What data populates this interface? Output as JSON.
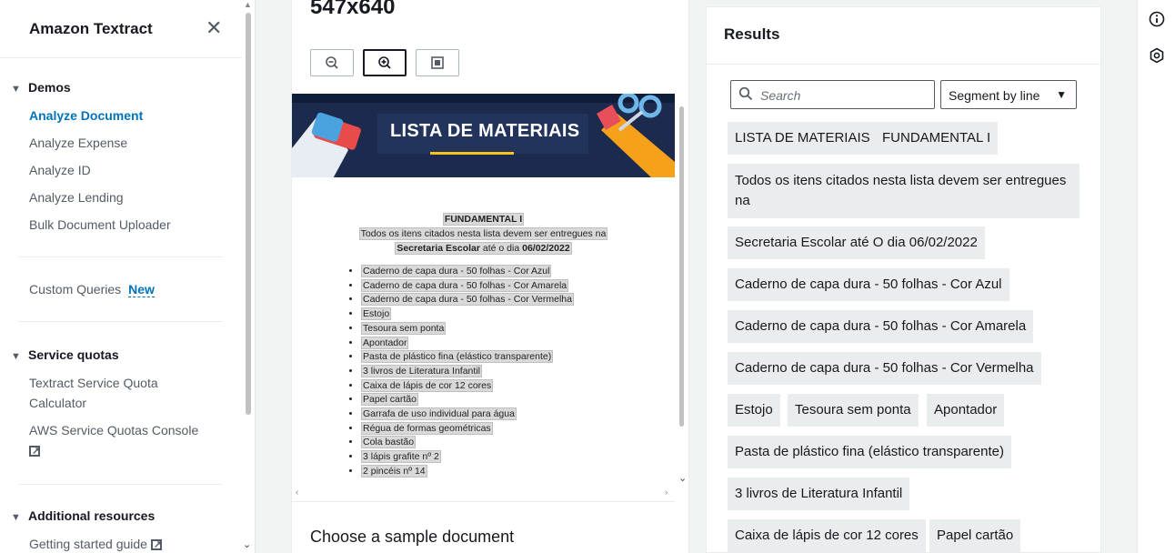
{
  "sidebar": {
    "title": "Amazon Textract",
    "sections": {
      "demos": "Demos",
      "service_quotas": "Service quotas",
      "additional_resources": "Additional resources"
    },
    "demos_items": [
      "Analyze Document",
      "Analyze Expense",
      "Analyze ID",
      "Analyze Lending",
      "Bulk Document Uploader"
    ],
    "custom_queries": "Custom Queries",
    "new_badge": "New",
    "quota_items": [
      "Textract Service Quota Calculator",
      "AWS Service Quotas Console"
    ],
    "resources_items": [
      "Getting started guide"
    ]
  },
  "viewer": {
    "dimensions": "547x640",
    "banner_title": "LISTA DE MATERIAIS",
    "doc_heading": "FUNDAMENTAL I",
    "doc_line1": "Todos os itens citados nesta lista devem ser entregues na",
    "doc_line2a": "Secretaria Escolar",
    "doc_line2b": "até o dia",
    "doc_line2c": "06/02/2022",
    "doc_items": [
      "Caderno de capa dura - 50 folhas - Cor Azul",
      "Caderno de capa dura - 50 folhas - Cor Amarela",
      "Caderno de capa dura - 50 folhas - Cor Vermelha",
      "Estojo",
      "Tesoura sem ponta",
      "Apontador",
      "Pasta de plástico fina (elástico transparente)",
      "3 livros de Literatura Infantil",
      "Caixa de lápis de cor 12 cores",
      "Papel cartão",
      "Garrafa de uso individual para água",
      "Régua de formas geométricas",
      "Cola bastão",
      "3 lápis grafite nº 2",
      "2 pincéis nº 14"
    ],
    "choose_label": "Choose a sample document"
  },
  "results": {
    "title": "Results",
    "search_placeholder": "Search",
    "segment_label": "Segment by line",
    "chips": [
      "LISTA DE MATERIAIS",
      "FUNDAMENTAL I",
      "Todos os itens citados nesta lista devem ser entregues na",
      "Secretaria Escolar até O dia 06/02/2022",
      "Caderno de capa dura - 50 folhas - Cor Azul",
      "Caderno de capa dura - 50 folhas - Cor Amarela",
      "Caderno de capa dura - 50 folhas - Cor Vermelha",
      "Estojo",
      "Tesoura sem ponta",
      "Apontador",
      "Pasta de plástico fina (elástico transparente)",
      "3 livros de Literatura Infantil",
      "Caixa de lápis de cor 12 cores",
      "Papel cartão"
    ]
  },
  "icons": {
    "zoom_out": "zoom-out-icon",
    "zoom_in": "zoom-in-icon",
    "fit": "fit-page-icon",
    "info": "info-icon",
    "settings": "hexagon-icon"
  },
  "colors": {
    "accent": "#0073bb",
    "chip_bg": "#eaeded",
    "banner_bg": "#1b2a4d"
  }
}
